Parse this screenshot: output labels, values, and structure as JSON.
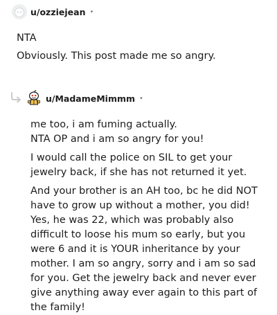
{
  "comments": [
    {
      "username": "u/ozziejean",
      "separator": "•",
      "avatar_icon": "default-avatar-icon",
      "paragraphs": [
        "NTA",
        "Obviously. This post made me so angry."
      ]
    },
    {
      "username": "u/MadameMimmm",
      "separator": "•",
      "avatar_icon": "snoo-avatar-icon",
      "reply_icon": "reply-arrow-icon",
      "paragraphs": [
        "me too, i am fuming actually.",
        "NTA OP and i am so angry for you!",
        "I would call the police on SIL to get your jewelry back, if she has not returned it yet.",
        "And your brother is an AH too, bc he did NOT have to grow up without a mother, you did! Yes, he was 22, which was probably also difficult to loose his mum so early, but you were 6 and it is YOUR inheritance by your mother. I am so angry, sorry and i am so sad for you. Get the jewelry back and never ever give anything away ever again to this part of the family!"
      ]
    }
  ],
  "colors": {
    "text": "#1c1c1c",
    "meta": "#787c7e",
    "avatar_bg": "#f0f1f2",
    "reply_line": "#c8cbcd"
  }
}
